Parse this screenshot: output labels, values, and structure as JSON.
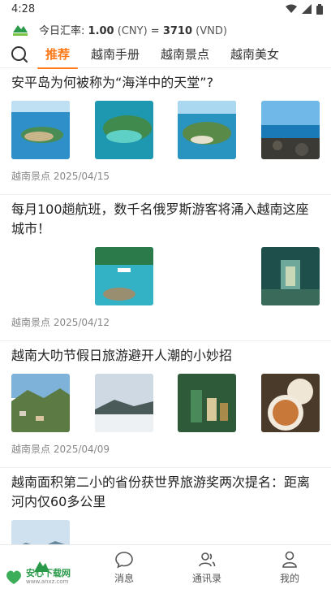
{
  "status": {
    "time": "4:28"
  },
  "rate": {
    "label": "今日汇率:",
    "cny_value": "1.00",
    "cny_unit": "(CNY)",
    "equals": "=",
    "vnd_value": "3710",
    "vnd_unit": "(VND)"
  },
  "tabs": [
    {
      "label": "推荐",
      "active": true
    },
    {
      "label": "越南手册",
      "active": false
    },
    {
      "label": "越南景点",
      "active": false
    },
    {
      "label": "越南美女",
      "active": false
    }
  ],
  "articles": [
    {
      "title": "安平岛为何被称为“海洋中的天堂”?",
      "meta": "越南景点 2025/04/15"
    },
    {
      "title": "每月100趟航班，数千名俄罗斯游客将涌入越南这座城市！",
      "meta": "越南景点 2025/04/12"
    },
    {
      "title": "越南大叻节假日旅游避开人潮的小妙招",
      "meta": "越南景点 2025/04/09"
    },
    {
      "title": "越南面积第二小的省份获世界旅游奖两次提名：距离河内仅60多公里",
      "meta": ""
    }
  ],
  "nav": [
    {
      "label": "",
      "icon": "home-icon"
    },
    {
      "label": "消息",
      "icon": "message-icon"
    },
    {
      "label": "通讯录",
      "icon": "contacts-icon"
    },
    {
      "label": "我的",
      "icon": "profile-icon"
    }
  ],
  "watermark": {
    "text": "安心下载网",
    "url": "www.anxz.com"
  },
  "colors": {
    "accent": "#ff7a1a",
    "brand_green": "#2a9a4a"
  }
}
